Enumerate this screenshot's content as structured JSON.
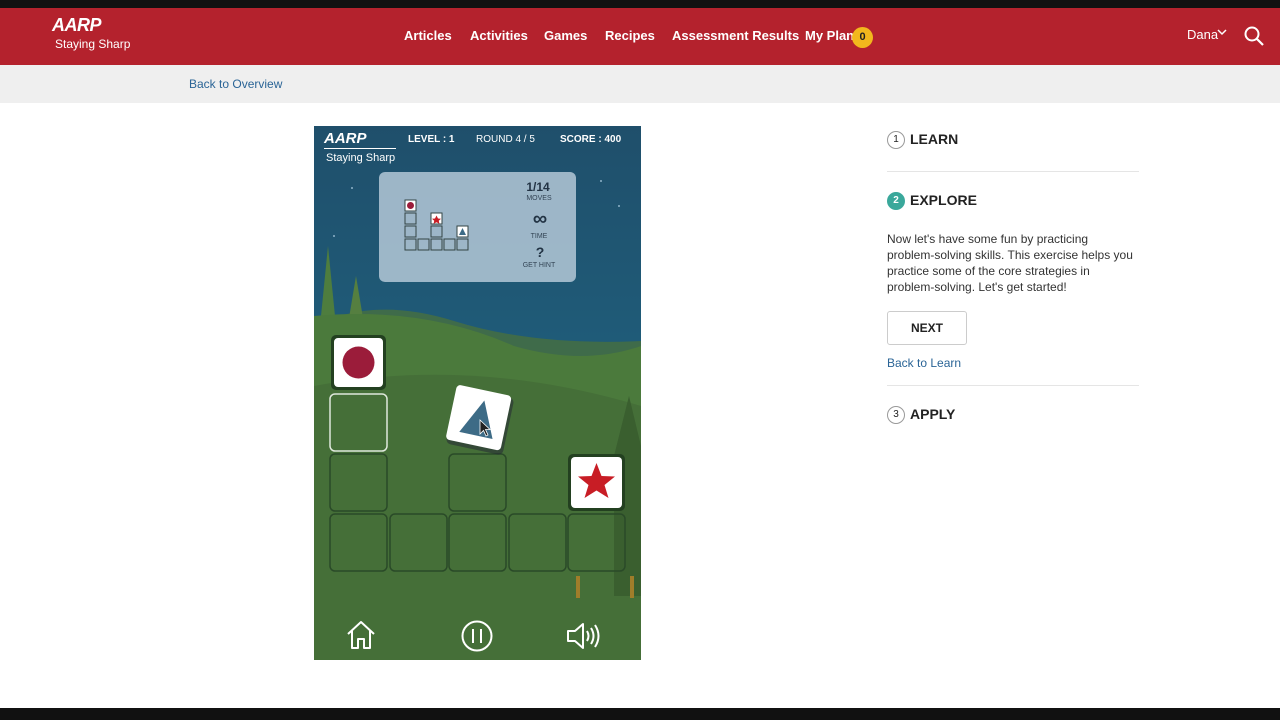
{
  "header": {
    "logo_brand": "AARP",
    "logo_sub": "Staying Sharp",
    "nav": [
      "Articles",
      "Activities",
      "Games",
      "Recipes",
      "Assessment Results",
      "My Plan"
    ],
    "plan_count": "0",
    "user": "Dana",
    "accent": "#b4222d"
  },
  "subbar": {
    "back_link": "Back to Overview"
  },
  "game": {
    "brand": "AARP",
    "brand_sub": "Staying Sharp",
    "level": "LEVEL : 1",
    "round": "ROUND 4 / 5",
    "score": "SCORE : 400",
    "moves_value": "1/14",
    "moves_label": "MOVES",
    "time_value": "∞",
    "time_label": "TIME",
    "hint_symbol": "?",
    "hint_label": "GET HINT",
    "controls": [
      "home-icon",
      "pause-icon",
      "volume-icon"
    ],
    "tile_colors": {
      "circle": "#9b1c3a",
      "triangle": "#3d6b86",
      "star": "#c81d25"
    }
  },
  "steps": {
    "learn": {
      "num": "1",
      "label": "LEARN"
    },
    "explore": {
      "num": "2",
      "label": "EXPLORE",
      "text": "Now let's have some fun by practicing problem-solving skills. This exercise helps you practice some of the core strategies in problem-solving. Let's get started!",
      "next_label": "NEXT",
      "back_link": "Back to Learn"
    },
    "apply": {
      "num": "3",
      "label": "APPLY"
    }
  }
}
